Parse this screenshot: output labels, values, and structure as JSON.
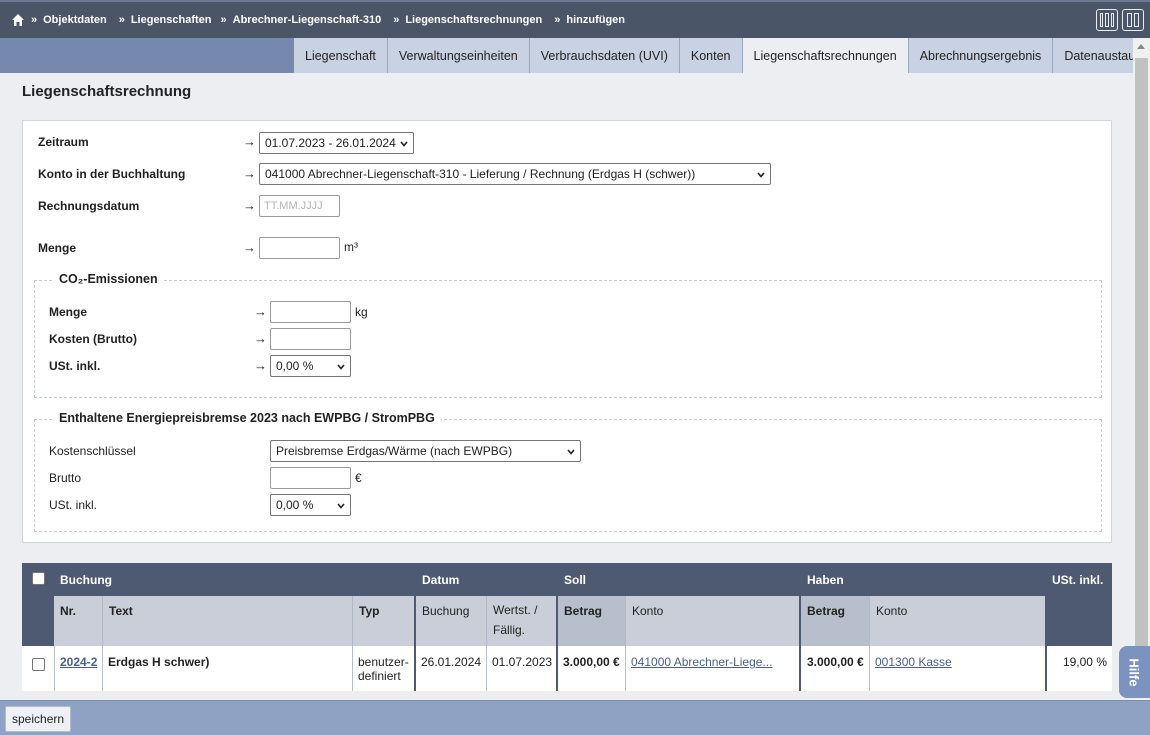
{
  "breadcrumb": {
    "items": [
      "Objektdaten",
      "Liegenschaften",
      "Abrechner-Liegenschaft-310",
      "Liegenschaftsrechnungen",
      "hinzufügen"
    ],
    "separator": "»"
  },
  "tabs": [
    {
      "label": "Liegenschaft"
    },
    {
      "label": "Verwaltungseinheiten"
    },
    {
      "label": "Verbrauchsdaten (UVI)"
    },
    {
      "label": "Konten"
    },
    {
      "label": "Liegenschaftsrechnungen",
      "active": true
    },
    {
      "label": "Abrechnungsergebnis"
    },
    {
      "label": "Datenaustausch"
    }
  ],
  "page_title": "Liegenschaftsrechnung",
  "form": {
    "arrow": "→",
    "zeitraum": {
      "label": "Zeitraum",
      "value": "01.07.2023 - 26.01.2024"
    },
    "konto": {
      "label": "Konto in der Buchhaltung",
      "value": "041000 Abrechner-Liegenschaft-310 - Lieferung / Rechnung (Erdgas H (schwer))"
    },
    "rechnungsdatum": {
      "label": "Rechnungsdatum",
      "placeholder": "TT.MM.JJJJ"
    },
    "menge": {
      "label": "Menge",
      "unit": "m³",
      "value": ""
    },
    "co2": {
      "legend": "CO₂-Emissionen",
      "menge": {
        "label": "Menge",
        "unit": "kg",
        "value": ""
      },
      "kosten": {
        "label": "Kosten (Brutto)",
        "value": ""
      },
      "ust": {
        "label": "USt. inkl.",
        "value": "0,00 %"
      }
    },
    "preisbremse": {
      "legend": "Enthaltene Energiepreisbremse 2023 nach EWPBG / StromPBG",
      "kostenschluessel": {
        "label": "Kostenschlüssel",
        "value": "Preisbremse Erdgas/Wärme (nach EWPBG)"
      },
      "brutto": {
        "label": "Brutto",
        "unit": "€",
        "value": ""
      },
      "ust": {
        "label": "USt. inkl.",
        "value": "0,00 %"
      }
    }
  },
  "table": {
    "groups": {
      "buchung": "Buchung",
      "datum": "Datum",
      "soll": "Soll",
      "haben": "Haben",
      "ust": "USt. inkl."
    },
    "columns": {
      "nr": "Nr.",
      "text": "Text",
      "typ": "Typ",
      "datum_buchung": "Buchung",
      "datum_wertst_1": "Wertst. /",
      "datum_wertst_2": "Fällig.",
      "soll_betrag": "Betrag",
      "soll_konto": "Konto",
      "haben_betrag": "Betrag",
      "haben_konto": "Konto"
    },
    "rows": [
      {
        "nr": "2024-2",
        "text": "Erdgas H schwer)",
        "typ_1": "benutzer-",
        "typ_2": "definiert",
        "buchung": "26.01.2024",
        "wertst": "01.07.2023",
        "soll_betrag": "3.000,00 €",
        "soll_konto": "041000 Abrechner-Liege...",
        "haben_betrag": "3.000,00 €",
        "haben_konto": "001300 Kasse",
        "ust": "19,00 %"
      }
    ]
  },
  "footer": {
    "save_label": "speichern"
  },
  "help_label": "Hilfe"
}
